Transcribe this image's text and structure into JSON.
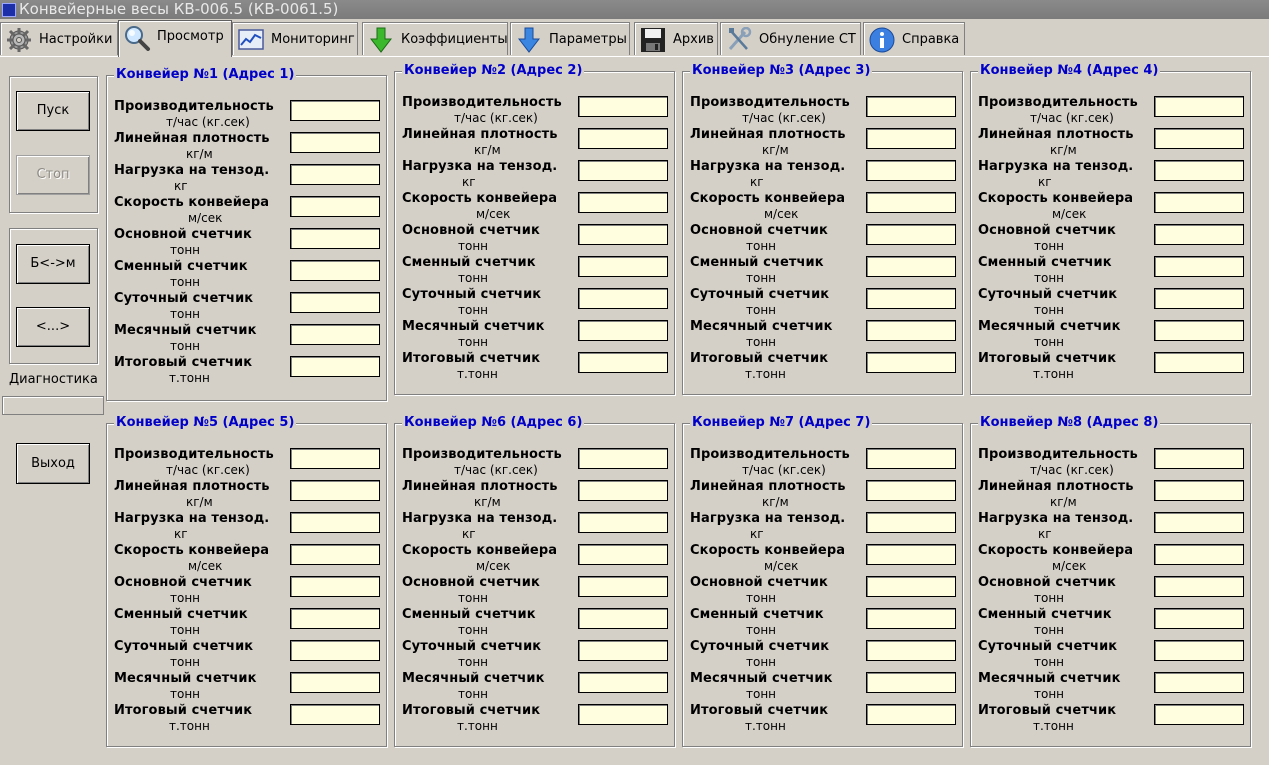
{
  "window": {
    "title": "Конвейерные весы КВ-006.5 (КВ-0061.5)"
  },
  "tabs": [
    {
      "label": "Настройки",
      "icon": "gear-icon",
      "active": false
    },
    {
      "label": "Просмотр",
      "icon": "magnifier-icon",
      "active": true
    },
    {
      "label": "Мониторинг",
      "icon": "chart-monitor-icon",
      "active": false
    },
    {
      "label": "Коэффициенты",
      "icon": "green-down-arrow-icon",
      "active": false
    },
    {
      "label": "Параметры",
      "icon": "blue-down-arrow-icon",
      "active": false
    },
    {
      "label": "Архив",
      "icon": "floppy-disk-icon",
      "active": false
    },
    {
      "label": "Обнуление СТ",
      "icon": "tools-icon",
      "active": false
    },
    {
      "label": "Справка",
      "icon": "info-icon",
      "active": false
    }
  ],
  "controls": {
    "start_label": "Пуск",
    "stop_label": "Стоп",
    "swap_label": "Б<->м",
    "nav_label": "<...>",
    "diagnostics_label": "Диагностика",
    "exit_label": "Выход"
  },
  "fields": [
    {
      "label": "Производительность",
      "unit": "т/час (кг.сек)"
    },
    {
      "label": "Линейная плотность",
      "unit": "кг/м"
    },
    {
      "label": "Нагрузка на тензод.",
      "unit": "кг"
    },
    {
      "label": "Скорость конвейера",
      "unit": "м/сек"
    },
    {
      "label": "Основной счетчик",
      "unit": "тонн"
    },
    {
      "label": "Сменный счетчик",
      "unit": "тонн"
    },
    {
      "label": "Суточный счетчик",
      "unit": "тонн"
    },
    {
      "label": "Месячный счетчик",
      "unit": "тонн"
    },
    {
      "label": "Итоговый счетчик",
      "unit": "т.тонн"
    }
  ],
  "conveyors": [
    {
      "title": "Конвейер №1 (Адрес 1)"
    },
    {
      "title": "Конвейер №2 (Адрес 2)"
    },
    {
      "title": "Конвейер №3 (Адрес 3)"
    },
    {
      "title": "Конвейер №4 (Адрес 4)"
    },
    {
      "title": "Конвейер №5 (Адрес 5)"
    },
    {
      "title": "Конвейер №6 (Адрес 6)"
    },
    {
      "title": "Конвейер №7 (Адрес 7)"
    },
    {
      "title": "Конвейер №8 (Адрес 8)"
    }
  ],
  "colors": {
    "title_text": "#0000c8",
    "field_bg": "#ffffe0",
    "window_bg": "#d4d0c8"
  }
}
